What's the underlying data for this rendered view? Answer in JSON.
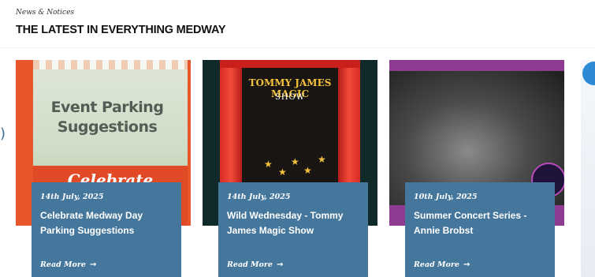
{
  "section": {
    "eyebrow": "News & Notices",
    "title": "THE LATEST IN EVERYTHING MEDWAY"
  },
  "carousel": {
    "prev_icon": "chevron-left-icon",
    "read_more_icon": "arrow-right-icon",
    "cards": [
      {
        "date": "14th July, 2025",
        "title": "Celebrate Medway Day Parking Suggestions",
        "read_more": "Read More",
        "image_text": "Event Parking Suggestions",
        "image_banner": "Celebrate"
      },
      {
        "date": "14th July, 2025",
        "title": "Wild Wednesday - Tommy James Magic Show",
        "read_more": "Read More",
        "image_text": "TOMMY JAMES MAGIC",
        "image_sub": "SHOW"
      },
      {
        "date": "10th July, 2025",
        "title": "Summer Concert Series - Annie Brobst",
        "read_more": "Read More"
      }
    ]
  },
  "colors": {
    "card_info_bg": "#45769c",
    "parking_accent": "#e8572c",
    "magic_bg": "#0f2a28",
    "concert_accent": "#8e3b91"
  }
}
